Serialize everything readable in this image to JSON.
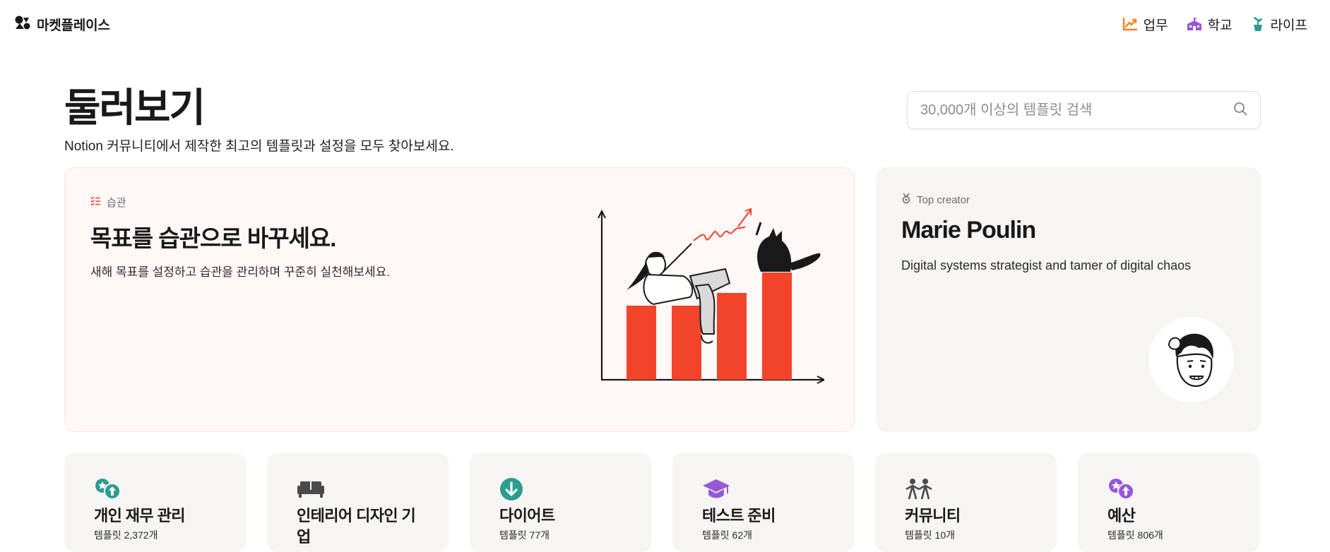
{
  "brand": {
    "name": "마켓플레이스",
    "icon": "notion-shapes-icon"
  },
  "topnav": [
    {
      "label": "업무",
      "icon": "chart-line-icon",
      "color": "#f5821f"
    },
    {
      "label": "학교",
      "icon": "school-icon",
      "color": "#9757d7"
    },
    {
      "label": "라이프",
      "icon": "plant-icon",
      "color": "#2a9d8f"
    }
  ],
  "page": {
    "title": "둘러보기",
    "subtitle": "Notion 커뮤니티에서 제작한 최고의 템플릿과 설정을 모두 찾아보세요."
  },
  "search": {
    "placeholder": "30,000개 이상의 템플릿 검색",
    "value": ""
  },
  "hero": {
    "tag": "습관",
    "title": "목표를 습관으로 바꾸세요.",
    "description": "새해 목표를 설정하고 습관을 관리하며 꾸준히 실천해보세요.",
    "accent": "#f2442b"
  },
  "creator": {
    "tag": "Top creator",
    "name": "Marie Poulin",
    "bio": "Digital systems strategist and tamer of digital chaos"
  },
  "categories": [
    {
      "name": "개인 재무 관리",
      "count": "템플릿 2,372개",
      "icon": "finance-icon",
      "color": "#2a9d8f"
    },
    {
      "name": "인테리어 디자인 기업",
      "count": "",
      "icon": "sofa-icon",
      "color": "#4a4a4a"
    },
    {
      "name": "다이어트",
      "count": "템플릿 77개",
      "icon": "arrow-down-circle-icon",
      "color": "#2a9d8f"
    },
    {
      "name": "테스트 준비",
      "count": "템플릿 62개",
      "icon": "graduation-cap-icon",
      "color": "#9757d7"
    },
    {
      "name": "커뮤니티",
      "count": "템플릿 10개",
      "icon": "people-icon",
      "color": "#4a4a4a"
    },
    {
      "name": "예산",
      "count": "템플릿 806개",
      "icon": "budget-icon",
      "color": "#9757d7"
    }
  ]
}
